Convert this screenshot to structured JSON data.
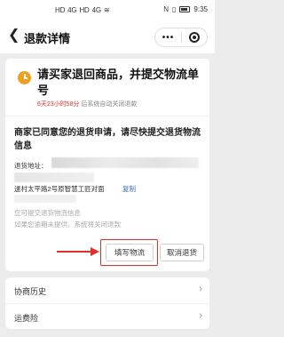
{
  "status_bar": {
    "left": [
      "HD",
      "4G",
      "HD",
      "4G",
      "WiFi"
    ],
    "right_icons": [
      "nfc-icon",
      "vibrate-icon",
      "battery-icon"
    ],
    "time": "9:35"
  },
  "nav": {
    "back_icon": "chevron-left-icon",
    "title": "退款详情",
    "more_icon": "more-dots-icon",
    "close_icon": "target-icon"
  },
  "main_card": {
    "title": "请买家退回商品，并提交物流单号",
    "countdown_value": "6天23小时58分",
    "countdown_suffix": " 后系统自动关闭退款",
    "subtitle": "商家已同意您的退货申请，请尽快提交退货物流信息",
    "address_label": "退货地址：",
    "address_line2": "逯村太平路2号原智慧工匠对面",
    "copy_label": "复制",
    "hint_1": "您可提交退货物流信息",
    "hint_2": "如果您逾期未提供，系统将关闭退款",
    "buttons": {
      "fill_logistics": "填写物流",
      "cancel_return": "取消退货"
    },
    "accent_color": "#e0302a",
    "clock_color": "#f0a020"
  },
  "list": [
    {
      "label": "协商历史"
    },
    {
      "label": "运费险"
    }
  ]
}
